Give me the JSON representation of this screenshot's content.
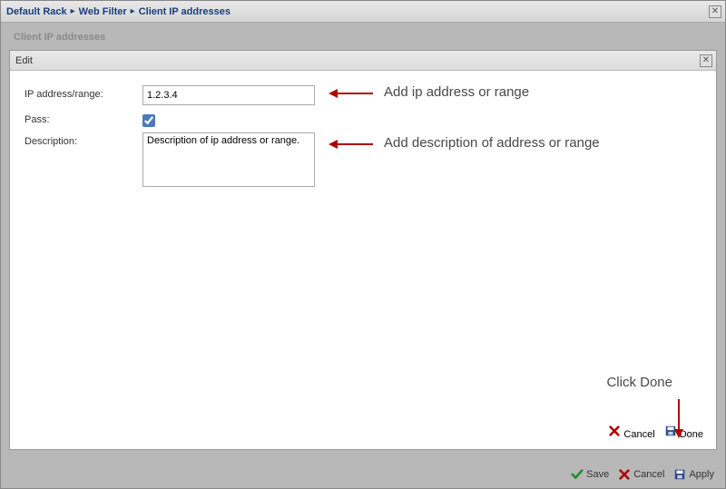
{
  "breadcrumb": {
    "items": [
      "Default Rack",
      "Web Filter",
      "Client IP addresses"
    ]
  },
  "ghost_tab": "Client IP addresses",
  "modal": {
    "title": "Edit",
    "labels": {
      "ip": "IP address/range:",
      "pass": "Pass:",
      "description": "Description:"
    },
    "values": {
      "ip": "1.2.3.4",
      "pass_checked": true,
      "description": "Description of ip address or range."
    },
    "buttons": {
      "cancel": "Cancel",
      "done": "Done"
    }
  },
  "bottom": {
    "save": "Save",
    "cancel": "Cancel",
    "apply": "Apply"
  },
  "annotations": {
    "ip": "Add ip address or range",
    "description": "Add description of address or range",
    "done": "Click Done"
  }
}
